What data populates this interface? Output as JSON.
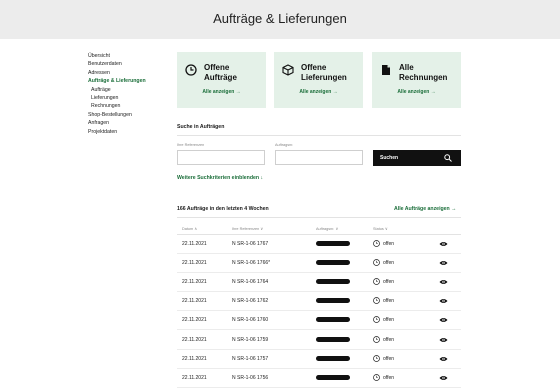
{
  "page_title": "Aufträge & Lieferungen",
  "sidebar": {
    "items": [
      {
        "label": "Übersicht",
        "active": false,
        "sub": false
      },
      {
        "label": "Benutzerdaten",
        "active": false,
        "sub": false
      },
      {
        "label": "Adressen",
        "active": false,
        "sub": false
      },
      {
        "label": "Aufträge & Lieferungen",
        "active": true,
        "sub": false
      },
      {
        "label": "Aufträge",
        "active": false,
        "sub": true
      },
      {
        "label": "Lieferungen",
        "active": false,
        "sub": true
      },
      {
        "label": "Rechnungen",
        "active": false,
        "sub": true
      },
      {
        "label": "Shop-Bestellungen",
        "active": false,
        "sub": false
      },
      {
        "label": "Anfragen",
        "active": false,
        "sub": false
      },
      {
        "label": "Projektdaten",
        "active": false,
        "sub": false
      }
    ]
  },
  "cards": [
    {
      "title_line1": "Offene",
      "title_line2": "Aufträge",
      "link": "Alle anzeigen",
      "icon": "clock-icon"
    },
    {
      "title_line1": "Offene",
      "title_line2": "Lieferungen",
      "link": "Alle anzeigen",
      "icon": "box-icon"
    },
    {
      "title_line1": "Alle",
      "title_line2": "Rechnungen",
      "link": "Alle anzeigen",
      "icon": "document-icon"
    }
  ],
  "search": {
    "title": "Suche in Aufträgen",
    "field1_label": "Ihre Referenzen",
    "field2_label": "Auftragsnr.",
    "button_label": "Suchen",
    "more_criteria": "Weitere Suchkriterien einblenden"
  },
  "orders": {
    "count_label": "166 Aufträge in den letzten 4 Wochen",
    "show_all_label": "Alle Aufträge anzeigen",
    "headers": {
      "date": "Datum ∧",
      "ref": "Ihre Referenzen ∨",
      "order": "Auftragsnr. ∨",
      "status": "Status ∨"
    },
    "rows": [
      {
        "date": "22.11.2021",
        "ref": "N SR-1-06 1767",
        "status": "offen"
      },
      {
        "date": "22.11.2021",
        "ref": "N SR-1-06 1766*",
        "status": "offen"
      },
      {
        "date": "22.11.2021",
        "ref": "N SR-1-06 1764",
        "status": "offen"
      },
      {
        "date": "22.11.2021",
        "ref": "N SR-1-06 1762",
        "status": "offen"
      },
      {
        "date": "22.11.2021",
        "ref": "N SR-1-06 1760",
        "status": "offen"
      },
      {
        "date": "22.11.2021",
        "ref": "N SR-1-06 1759",
        "status": "offen"
      },
      {
        "date": "22.11.2021",
        "ref": "N SR-1-06 1757",
        "status": "offen"
      },
      {
        "date": "22.11.2021",
        "ref": "N SR-1-06 1756",
        "status": "offen"
      }
    ]
  },
  "colors": {
    "accent": "#1b6e3a",
    "card_bg": "#e4f1e8",
    "header_bg": "#ececec"
  }
}
